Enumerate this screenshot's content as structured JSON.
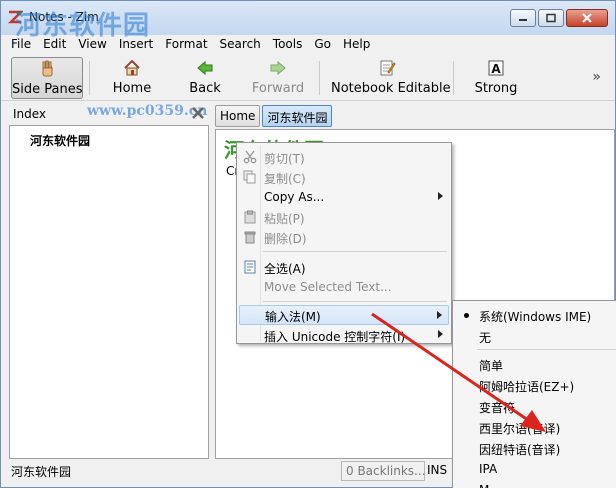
{
  "window": {
    "title": "Notes - Zim",
    "watermark": "河东软件园",
    "watermark_url": "www.pc0359.cn"
  },
  "menubar": [
    "File",
    "Edit",
    "View",
    "Insert",
    "Format",
    "Search",
    "Tools",
    "Go",
    "Help"
  ],
  "toolbar": {
    "side_panes": "Side Panes",
    "home": "Home",
    "back": "Back",
    "forward": "Forward",
    "notebook_editable": "Notebook Editable",
    "strong": "Strong",
    "more": "»"
  },
  "side_pane": {
    "title": "Index",
    "items": [
      "河东软件园"
    ]
  },
  "pathbar": [
    "Home",
    "河东软件园"
  ],
  "page": {
    "heading": "河东软件园",
    "created": "Cr"
  },
  "statusbar": {
    "page": "河东软件园",
    "backlinks": "0 Backlinks...",
    "mode": "INS"
  },
  "context_menu": {
    "cut": "剪切(T)",
    "copy": "复制(C)",
    "copy_as": "Copy As...",
    "paste": "粘贴(P)",
    "delete": "删除(D)",
    "select_all": "全选(A)",
    "move_selected": "Move Selected Text...",
    "input_method": "输入法(M)",
    "insert_unicode": "插入 Unicode 控制字符(I)"
  },
  "input_methods": {
    "selected": "系统(Windows IME)",
    "none": "无",
    "items": [
      "简单",
      "阿姆哈拉语(EZ+)",
      "变音符",
      "西里尔语(音译)",
      "因纽特语(音译)",
      "IPA",
      "M..."
    ]
  },
  "colors": {
    "heading_green": "#3a9a2a",
    "arrow_red": "#d9251d",
    "path_selected": "#b6d4f1"
  }
}
